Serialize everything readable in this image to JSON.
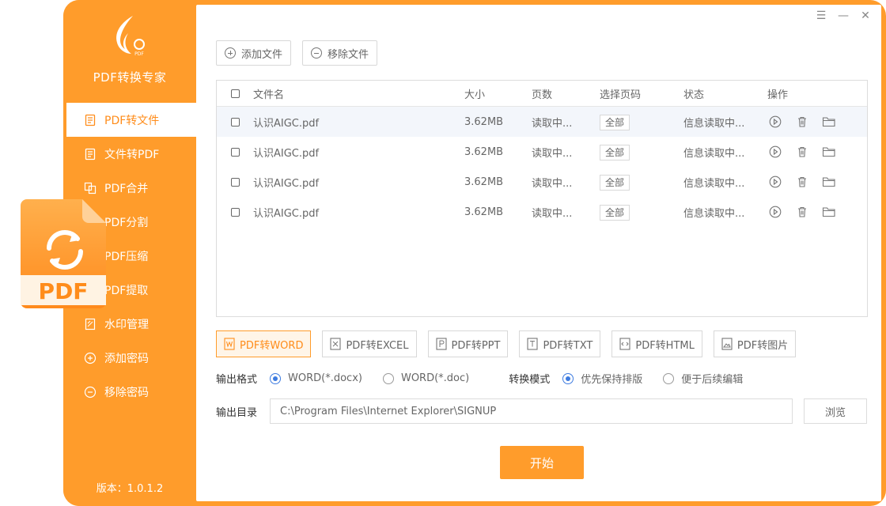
{
  "app": {
    "name": "PDF转换专家",
    "version": "版本：1.0.1.2",
    "accent": "#ff9c2b"
  },
  "sidebar": {
    "items": [
      {
        "label": "PDF转文件",
        "icon": "document-icon",
        "active": true
      },
      {
        "label": "文件转PDF",
        "icon": "document-icon",
        "active": false
      },
      {
        "label": "PDF合并",
        "icon": "merge-icon",
        "active": false
      },
      {
        "label": "PDF分割",
        "icon": "split-icon",
        "active": false
      },
      {
        "label": "PDF压缩",
        "icon": "compress-icon",
        "active": false
      },
      {
        "label": "PDF提取",
        "icon": "extract-icon",
        "active": false
      },
      {
        "label": "水印管理",
        "icon": "watermark-icon",
        "active": false
      },
      {
        "label": "添加密码",
        "icon": "plus-circle-icon",
        "active": false
      },
      {
        "label": "移除密码",
        "icon": "minus-circle-icon",
        "active": false
      }
    ]
  },
  "window_controls": {
    "menu": "☰",
    "minimize": "—",
    "close": "✕"
  },
  "toolbar": {
    "add_label": "添加文件",
    "remove_label": "移除文件"
  },
  "table": {
    "headers": {
      "name": "文件名",
      "size": "大小",
      "pages": "页数",
      "select": "选择页码",
      "status": "状态",
      "ops": "操作"
    },
    "rows": [
      {
        "name": "认识AIGC.pdf",
        "size": "3.62MB",
        "pages": "读取中...",
        "select": "全部",
        "status": "信息读取中..."
      },
      {
        "name": "认识AIGC.pdf",
        "size": "3.62MB",
        "pages": "读取中...",
        "select": "全部",
        "status": "信息读取中..."
      },
      {
        "name": "认识AIGC.pdf",
        "size": "3.62MB",
        "pages": "读取中...",
        "select": "全部",
        "status": "信息读取中..."
      },
      {
        "name": "认识AIGC.pdf",
        "size": "3.62MB",
        "pages": "读取中...",
        "select": "全部",
        "status": "信息读取中..."
      }
    ]
  },
  "formats": [
    {
      "label": "PDF转WORD",
      "active": true
    },
    {
      "label": "PDF转EXCEL",
      "active": false
    },
    {
      "label": "PDF转PPT",
      "active": false
    },
    {
      "label": "PDF转TXT",
      "active": false
    },
    {
      "label": "PDF转HTML",
      "active": false
    },
    {
      "label": "PDF转图片",
      "active": false
    }
  ],
  "options": {
    "format_label": "输出格式",
    "format_choices": [
      {
        "label": "WORD(*.docx)",
        "selected": true
      },
      {
        "label": "WORD(*.doc)",
        "selected": false
      }
    ],
    "mode_label": "转换模式",
    "mode_choices": [
      {
        "label": "优先保持排版",
        "selected": true
      },
      {
        "label": "便于后续编辑",
        "selected": false
      }
    ]
  },
  "output": {
    "label": "输出目录",
    "path": "C:\\Program Files\\Internet Explorer\\SIGNUP",
    "browse_label": "浏览"
  },
  "start_label": "开始",
  "float_icon": {
    "text": "PDF"
  },
  "logo": {
    "text": "PDF"
  }
}
